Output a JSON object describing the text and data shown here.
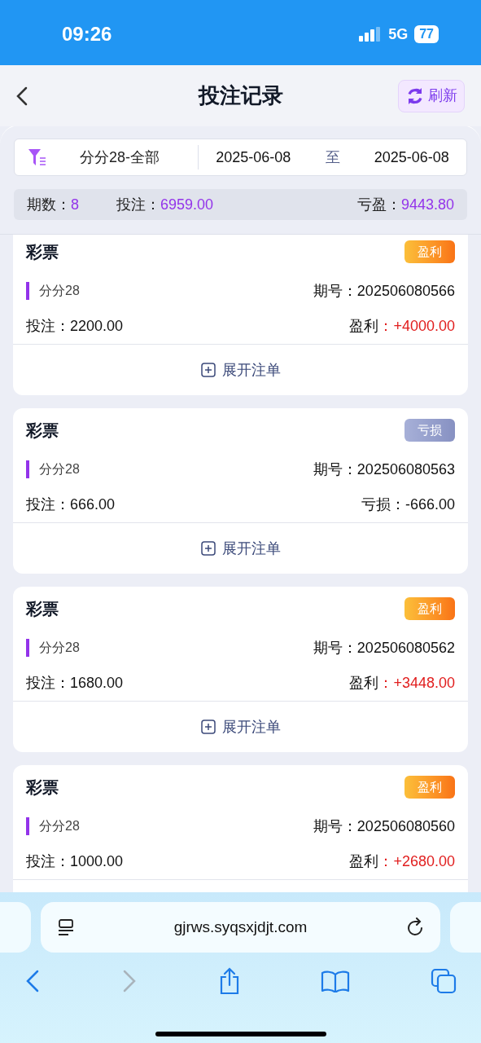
{
  "status_bar": {
    "time": "09:26",
    "network": "5G",
    "battery": "77"
  },
  "header": {
    "title": "投注记录",
    "refresh_label": "刷新"
  },
  "filter": {
    "lottery": "分分28-全部",
    "date_from": "2025-06-08",
    "date_sep": "至",
    "date_to": "2025-06-08"
  },
  "summary": [
    {
      "label": "期数：",
      "value": "8"
    },
    {
      "label": "投注：",
      "value": "6959.00"
    },
    {
      "label": "亏盈：",
      "value": "9443.80"
    }
  ],
  "records": [
    {
      "title": "彩票",
      "badge": "盈利",
      "kind": "profit",
      "game": "分分28",
      "issue_label": "期号：",
      "issue": "202506080566",
      "bet_label": "投注：",
      "bet": "2200.00",
      "result_label": "盈利",
      "result_colon": "：",
      "result": "+4000.00",
      "expand": "展开注单"
    },
    {
      "title": "彩票",
      "badge": "亏损",
      "kind": "loss",
      "game": "分分28",
      "issue_label": "期号：",
      "issue": "202506080563",
      "bet_label": "投注：",
      "bet": "666.00",
      "result_label": "亏损",
      "result_colon": "：",
      "result": "-666.00",
      "expand": "展开注单"
    },
    {
      "title": "彩票",
      "badge": "盈利",
      "kind": "profit",
      "game": "分分28",
      "issue_label": "期号：",
      "issue": "202506080562",
      "bet_label": "投注：",
      "bet": "1680.00",
      "result_label": "盈利",
      "result_colon": "：",
      "result": "+3448.00",
      "expand": "展开注单"
    },
    {
      "title": "彩票",
      "badge": "盈利",
      "kind": "profit",
      "game": "分分28",
      "issue_label": "期号：",
      "issue": "202506080560",
      "bet_label": "投注：",
      "bet": "1000.00",
      "result_label": "盈利",
      "result_colon": "：",
      "result": "+2680.00"
    }
  ],
  "browser": {
    "url": "gjrws.syqsxjdjt.com"
  }
}
